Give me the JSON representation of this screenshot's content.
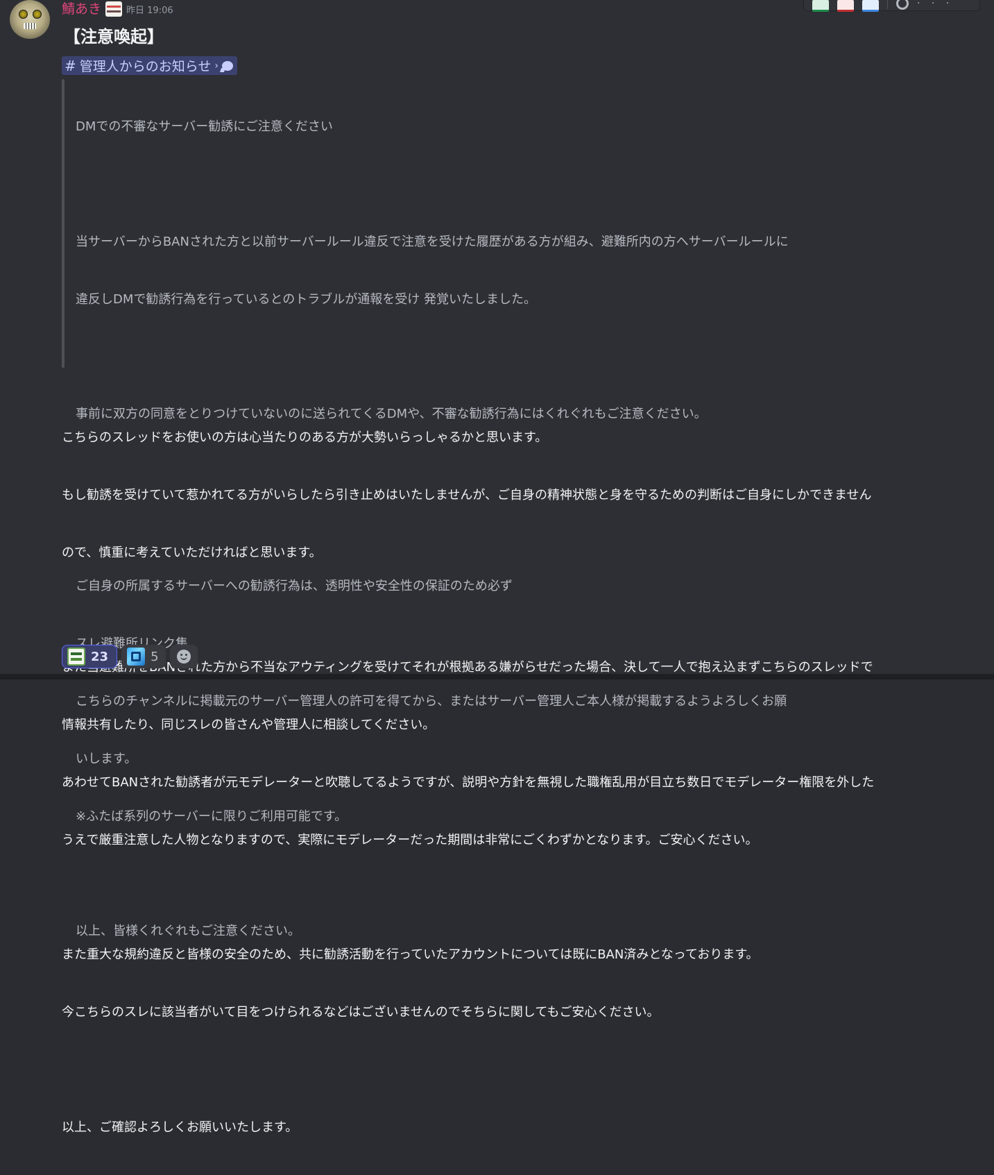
{
  "message": {
    "author": "鯖あき",
    "timestamp": "昨日 19:06",
    "title": "【注意喚起】",
    "channel_mention": {
      "hash": "#",
      "name": "管理人からのお知らせ",
      "chevron": "›"
    },
    "quote_lines": [
      "DMでの不審なサーバー勧誘にご注意ください",
      "",
      "当サーバーからBANされた方と以前サーバールール違反で注意を受けた履歴がある方が組み、避難所内の方へサーバールールに",
      "違反しDMで勧誘行為を行っているとのトラブルが通報を受け 発覚いたしました。",
      "",
      "事前に双方の同意をとりつけていないのに送られてくるDMや、不審な勧誘行為にはくれぐれもご注意ください。",
      "",
      "",
      "ご自身の所属するサーバーへの勧誘行為は、透明性や安全性の保証のため必ず",
      "スレ避難所リンク集",
      "こちらのチャンネルに掲載元のサーバー管理人の許可を得てから、またはサーバー管理人ご本人様が掲載するようよろしくお願",
      "いします。",
      "※ふたば系列のサーバーに限りご利用可能です。",
      "",
      "以上、皆様くれぐれもご注意ください。"
    ],
    "body_lines": [
      "こちらのスレッドをお使いの方は心当たりのある方が大勢いらっしゃるかと思います。",
      "もし勧誘を受けていて惹かれてる方がいらしたら引き止めはいたしませんが、ご自身の精神状態と身を守るための判断はご自身にしかできません",
      "ので、慎重に考えていただければと思います。",
      "",
      "また当避難所をBANされた方から不当なアウティングを受けてそれが根拠ある嫌がらせだった場合、決して一人で抱え込まずこちらのスレッドで",
      "情報共有したり、同じスレの皆さんや管理人に相談してください。",
      "あわせてBANされた勧誘者が元モデレーターと吹聴してるようですが、説明や方針を無視した職権乱用が目立ち数日でモデレーター権限を外した",
      "うえで厳重注意した人物となりますので、実際にモデレーターだった期間は非常にごくわずかとなります。ご安心ください。",
      "",
      "また重大な規約違反と皆様の安全のため、共に勧誘活動を行っていたアカウントについては既にBAN済みとなっております。",
      "今こちらのスレに該当者がいて目をつけられるなどはございませんのでそちらに関してもご安心ください。",
      "",
      "以上、ご確認よろしくお願いいたします。"
    ],
    "reactions": [
      {
        "emoji": "custom-emoji-green",
        "count": "23",
        "active": true
      },
      {
        "emoji": "custom-emoji-blue",
        "count": "5",
        "active": false
      }
    ]
  },
  "icons": {
    "add_reaction": "smiley-icon",
    "more": "ellipsis-icon"
  },
  "colors": {
    "background": "#2e2f34",
    "username": "#e0457a",
    "mention_bg": "#3c4270",
    "mention_text": "#c9cdfb",
    "reaction_active_border": "#5865f2"
  }
}
